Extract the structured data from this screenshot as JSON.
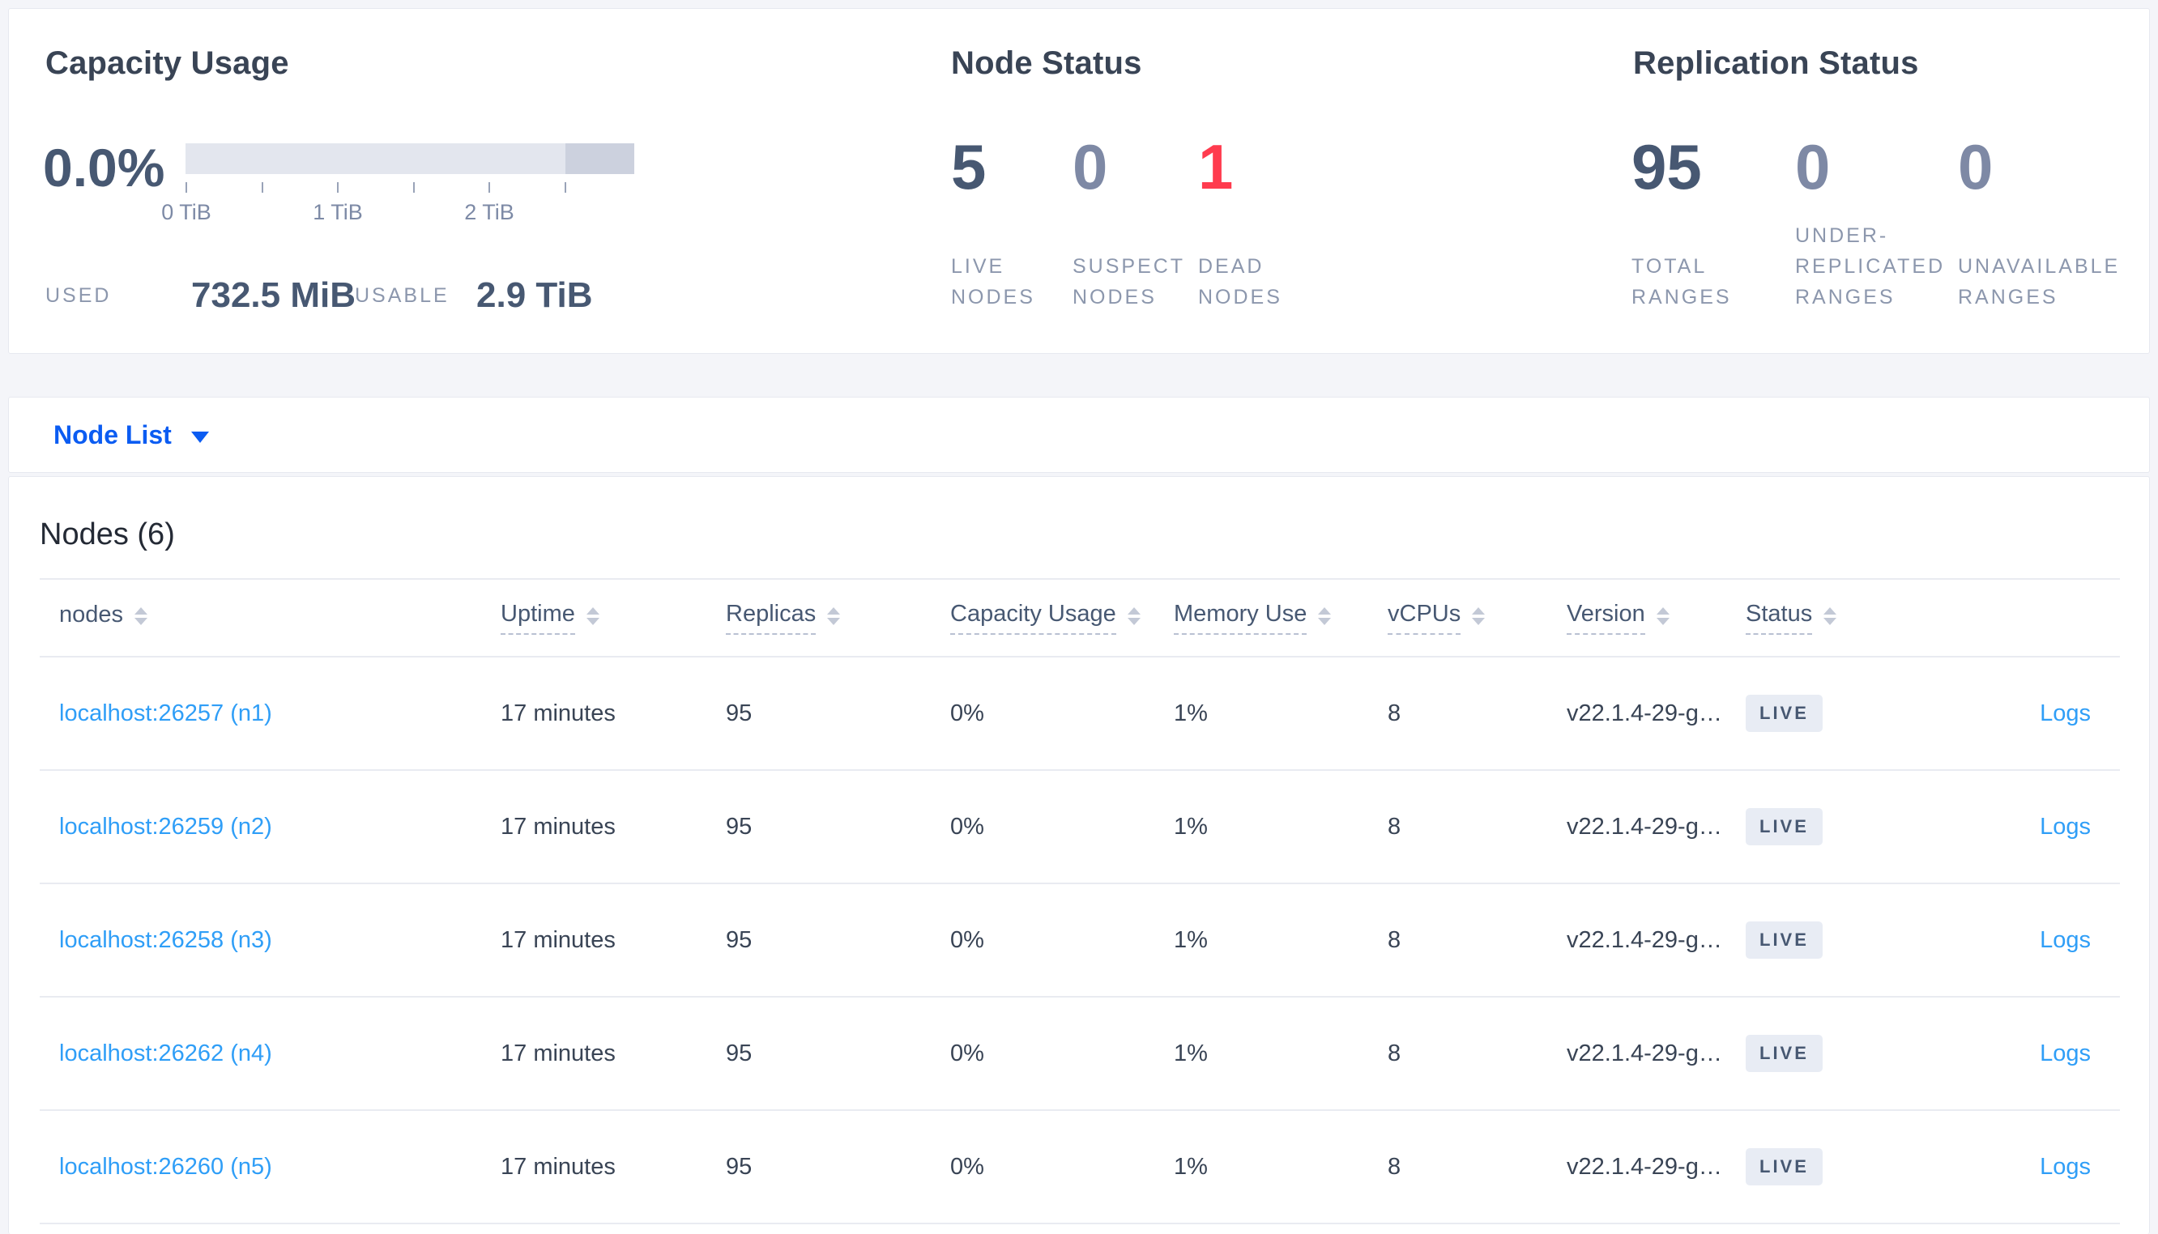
{
  "summary": {
    "capacity": {
      "title": "Capacity Usage",
      "percent": "0.0%",
      "ticks": [
        "0 TiB",
        "1 TiB",
        "2 TiB"
      ],
      "used_label": "USED",
      "used_value": "732.5 MiB",
      "usable_label": "USABLE",
      "usable_value": "2.9 TiB"
    },
    "node_status": {
      "title": "Node Status",
      "live": {
        "value": "5",
        "label": "LIVE NODES"
      },
      "suspect": {
        "value": "0",
        "label": "SUSPECT NODES"
      },
      "dead": {
        "value": "1",
        "label": "DEAD NODES"
      }
    },
    "replication": {
      "title": "Replication Status",
      "total": {
        "value": "95",
        "label": "TOTAL RANGES"
      },
      "under": {
        "value": "0",
        "label": "UNDER-REPLICATED RANGES"
      },
      "unavailable": {
        "value": "0",
        "label": "UNAVAILABLE RANGES"
      }
    }
  },
  "node_list": {
    "label": "Node List"
  },
  "nodes_section": {
    "title": "Nodes (6)",
    "columns": [
      "nodes",
      "Uptime",
      "Replicas",
      "Capacity Usage",
      "Memory Use",
      "vCPUs",
      "Version",
      "Status"
    ],
    "rows": [
      {
        "address": "localhost:26257 (n1)",
        "uptime": "17 minutes",
        "replicas": "95",
        "capacity": "0%",
        "memory": "1%",
        "vcpus": "8",
        "version": "v22.1.4-29-g…",
        "status": "LIVE",
        "logs": "Logs"
      },
      {
        "address": "localhost:26259 (n2)",
        "uptime": "17 minutes",
        "replicas": "95",
        "capacity": "0%",
        "memory": "1%",
        "vcpus": "8",
        "version": "v22.1.4-29-g…",
        "status": "LIVE",
        "logs": "Logs"
      },
      {
        "address": "localhost:26258 (n3)",
        "uptime": "17 minutes",
        "replicas": "95",
        "capacity": "0%",
        "memory": "1%",
        "vcpus": "8",
        "version": "v22.1.4-29-g…",
        "status": "LIVE",
        "logs": "Logs"
      },
      {
        "address": "localhost:26262 (n4)",
        "uptime": "17 minutes",
        "replicas": "95",
        "capacity": "0%",
        "memory": "1%",
        "vcpus": "8",
        "version": "v22.1.4-29-g…",
        "status": "LIVE",
        "logs": "Logs"
      },
      {
        "address": "localhost:26260 (n5)",
        "uptime": "17 minutes",
        "replicas": "95",
        "capacity": "0%",
        "memory": "1%",
        "vcpus": "8",
        "version": "v22.1.4-29-g…",
        "status": "LIVE",
        "logs": "Logs"
      }
    ]
  },
  "colors": {
    "page_background": "#f4f5f9",
    "title_text": "#394455",
    "stat_value": "#475872",
    "stat_muted": "#7e89a5",
    "stat_danger": "#ff3b4e",
    "label_gray": "#8c97ad",
    "link_blue": "#2f9ef7",
    "dropdown_blue": "#0b5cf2",
    "bar_light": "#e3e6ee",
    "bar_dark": "#ccd1de",
    "badge_background": "#e8ecf4",
    "divider": "#e9ebf1"
  }
}
